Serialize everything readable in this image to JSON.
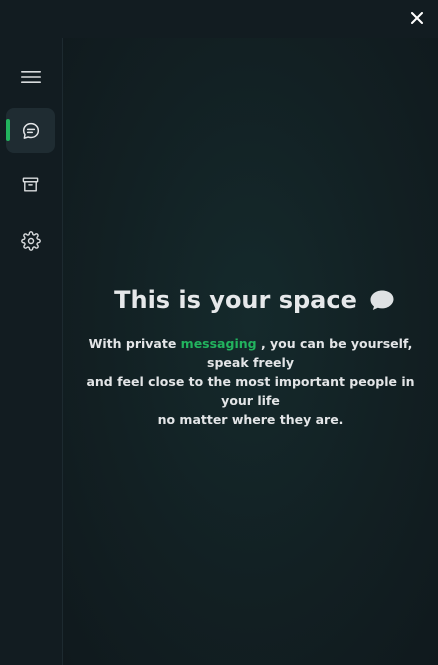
{
  "window": {
    "close_icon": "close-icon"
  },
  "sidebar": {
    "items": [
      {
        "name": "menu",
        "icon": "hamburger-menu-icon"
      },
      {
        "name": "chats",
        "icon": "chat-bubble-icon",
        "active": true
      },
      {
        "name": "archive",
        "icon": "archive-box-icon"
      },
      {
        "name": "settings",
        "icon": "gear-icon"
      }
    ]
  },
  "hero": {
    "title": "This is your space",
    "title_icon": "speech-bubble-icon",
    "line1_prefix": "With private",
    "line1_highlight": "messaging",
    "line1_suffix": ", you can be yourself, speak freely",
    "line2": "and feel close to the most important people in your life",
    "line3": "no matter where they are."
  },
  "colors": {
    "accent": "#22b35e",
    "background": "#121c21",
    "text": "#e6e8ea"
  }
}
